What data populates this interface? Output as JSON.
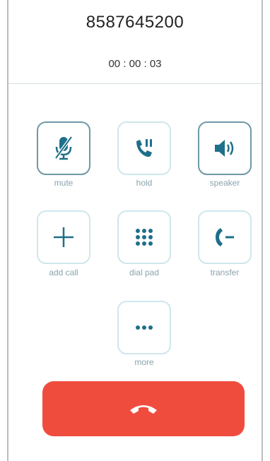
{
  "call": {
    "phone_number": "8587645200",
    "duration": "00 : 00 : 03"
  },
  "controls": [
    {
      "id": "mute",
      "label": "mute",
      "icon": "microphone-muted-icon",
      "active": true
    },
    {
      "id": "hold",
      "label": "hold",
      "icon": "phone-hold-icon",
      "active": false
    },
    {
      "id": "speaker",
      "label": "speaker",
      "icon": "speaker-icon",
      "active": true
    },
    {
      "id": "add-call",
      "label": "add call",
      "icon": "plus-icon",
      "active": false
    },
    {
      "id": "dial-pad",
      "label": "dial pad",
      "icon": "keypad-icon",
      "active": false
    },
    {
      "id": "transfer",
      "label": "transfer",
      "icon": "transfer-icon",
      "active": false
    },
    {
      "id": "more",
      "label": "more",
      "icon": "more-dots-icon",
      "active": false
    }
  ],
  "colors": {
    "accent": "#1e6f8a",
    "button_border": "#cfe6ec",
    "active_border": "#6f98a6",
    "label": "#8aa4ad",
    "end_call": "#f04c3e"
  }
}
